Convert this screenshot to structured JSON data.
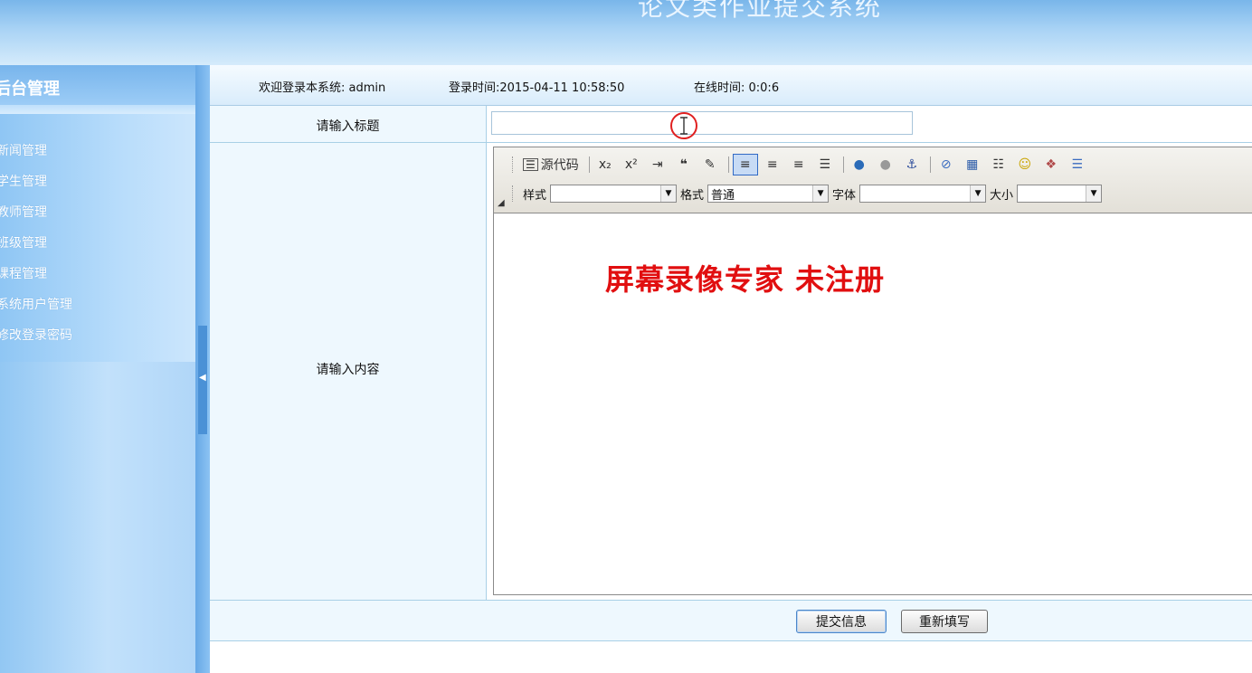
{
  "header": {
    "title": "论文类作业提交系统"
  },
  "sidebar": {
    "heading": "后台管理",
    "items": [
      {
        "label": "新闻管理"
      },
      {
        "label": "学生管理"
      },
      {
        "label": "教师管理"
      },
      {
        "label": "班级管理"
      },
      {
        "label": "课程管理"
      },
      {
        "label": "系统用户管理"
      },
      {
        "label": "修改登录密码"
      }
    ]
  },
  "infobar": {
    "welcome": "欢迎登录本系统: admin",
    "login_time": "登录时间:2015-04-11 10:58:50",
    "online_time": "在线时间: 0:0:6"
  },
  "form": {
    "title_label": "请输入标题",
    "title_value": "",
    "content_label": "请输入内容",
    "submit_label": "提交信息",
    "reset_label": "重新填写"
  },
  "editor": {
    "source_label": "源代码",
    "style_label": "样式",
    "style_value": "",
    "format_label": "格式",
    "format_value": "普通",
    "font_label": "字体",
    "font_value": "",
    "size_label": "大小",
    "size_value": "",
    "watermark": "屏幕录像专家  未注册"
  },
  "colors": {
    "header_bg": "#a9d3f5",
    "sidebar_bg": "#b7dcfb",
    "watermark": "#e10f10"
  }
}
